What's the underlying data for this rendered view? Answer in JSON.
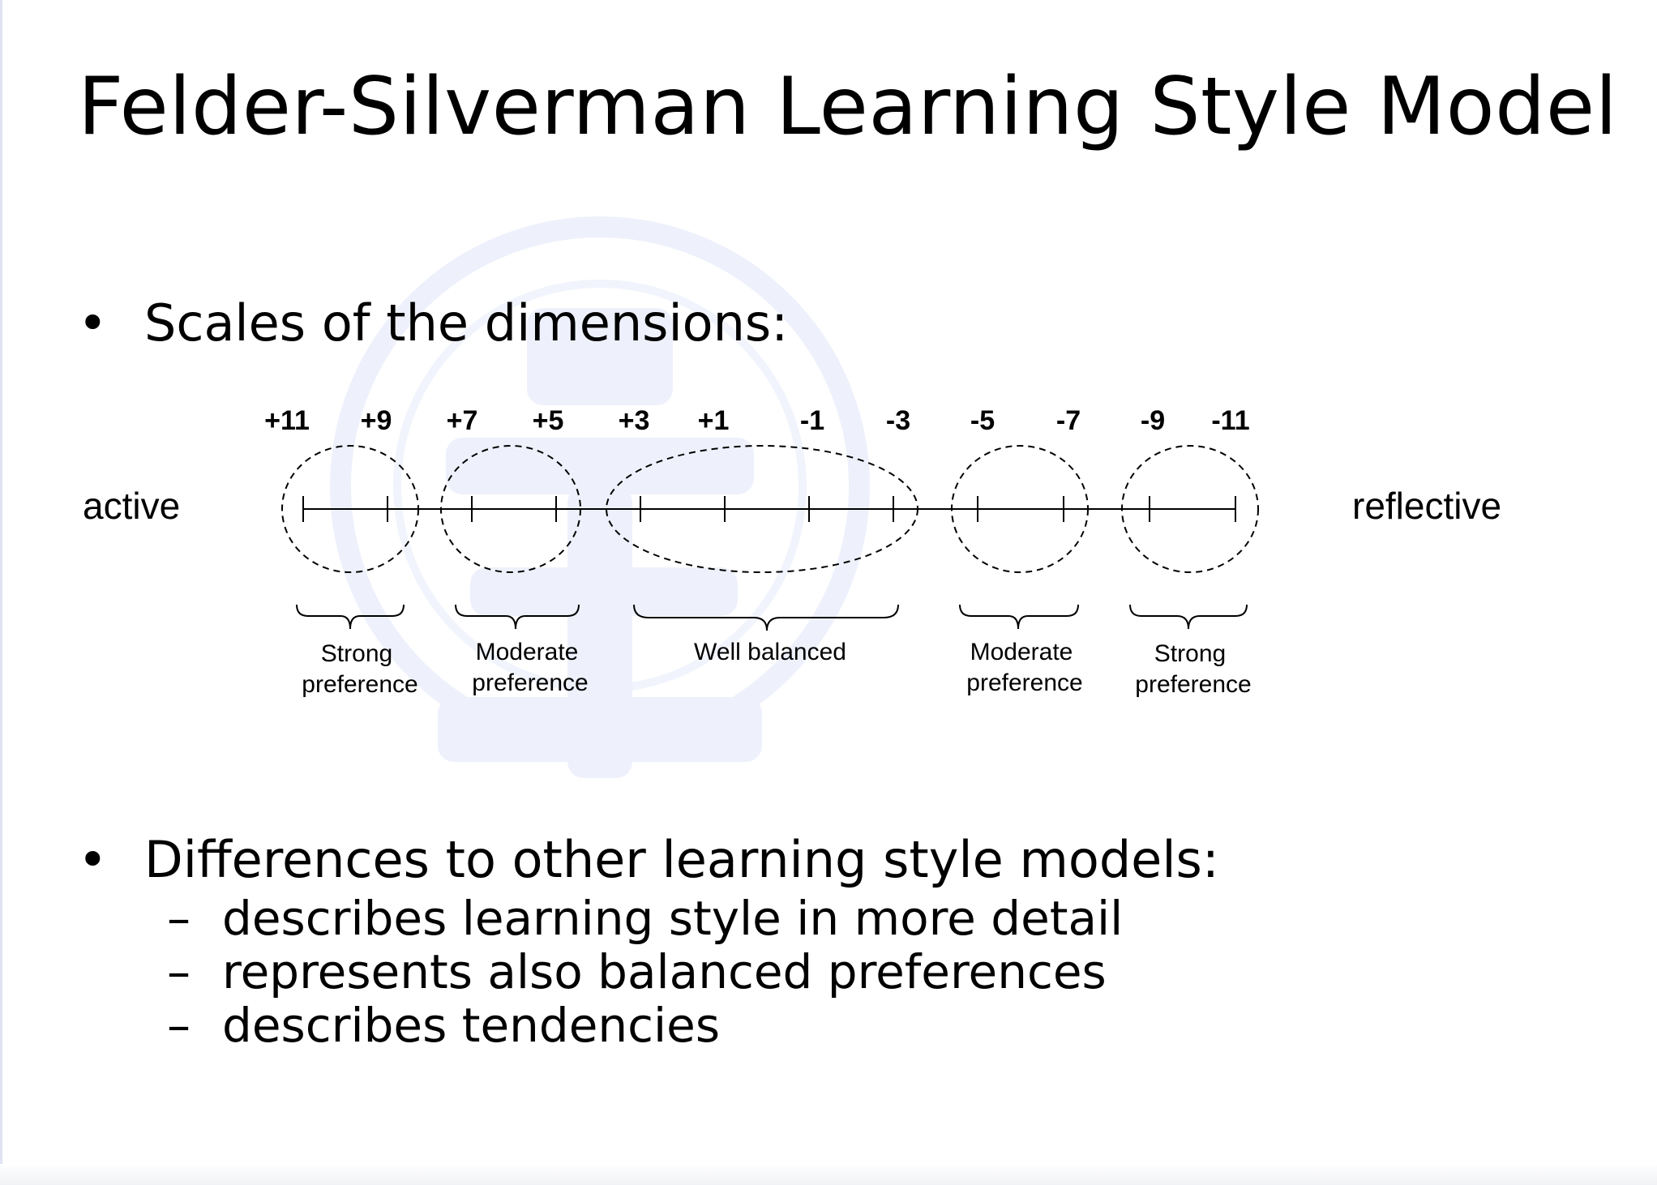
{
  "title": "Felder-Silverman Learning Style Model",
  "bullets": [
    {
      "text": "Scales of the dimensions:"
    },
    {
      "text": "Differences to other learning style models:",
      "subitems": [
        "describes learning style in more detail",
        "represents also balanced preferences",
        "describes tendencies"
      ]
    }
  ],
  "scale": {
    "left_label": "active",
    "right_label": "reflective",
    "ticks": [
      "+11",
      "+9",
      "+7",
      "+5",
      "+3",
      "+1",
      "-1",
      "-3",
      "-5",
      "-7",
      "-9",
      "-11"
    ],
    "groups": [
      {
        "lines": [
          "Strong",
          "preference"
        ]
      },
      {
        "lines": [
          "Moderate",
          "preference"
        ]
      },
      {
        "lines": [
          "Well balanced"
        ]
      },
      {
        "lines": [
          "Moderate",
          "preference"
        ]
      },
      {
        "lines": [
          "Strong",
          "preference"
        ]
      }
    ]
  },
  "colors": {
    "watermark": "#eef1fb",
    "rule": "#dfe3f3"
  }
}
